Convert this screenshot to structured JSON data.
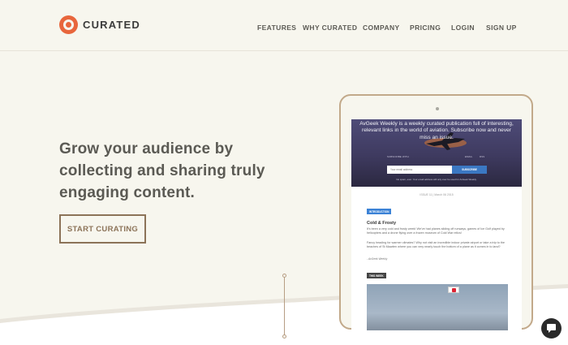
{
  "brand": {
    "name": "CURATED",
    "accent": "#e8663c"
  },
  "nav": {
    "items": [
      {
        "label": "FEATURES"
      },
      {
        "label": "WHY CURATED"
      },
      {
        "label": "COMPANY"
      },
      {
        "label": "PRICING"
      },
      {
        "label": "LOGIN"
      },
      {
        "label": "SIGN UP"
      }
    ]
  },
  "hero": {
    "headline": "Grow your audience by collecting and sharing truly engaging content.",
    "cta_label": "START CURATING"
  },
  "newsletter_preview": {
    "hero_text": "AvGeek Weekly is a weekly curated publication full of interesting, relevant links in the world of aviation. Subscribe now and never miss an issue.",
    "sub_links": [
      "SUBSCRIBE WITH",
      "EMAIL",
      "RSS"
    ],
    "email_placeholder": "Your email address",
    "subscribe_label": "SUBSCRIBE",
    "spam_note": "No spam, ever. Your email address will only ever be used for AvGeek Weekly.",
    "issue_line": "ISSUE 11 | March 06 2015",
    "intro_tag": "INTRODUCTION",
    "article_title": "Cold & Frosty",
    "paragraph_1": "It's been a very cold and frosty week! We've had planes sliding off runways, games of Ice Golf played by helicopters and a drone flying over a frozen museum of Cold War relics!",
    "paragraph_2": "Fancy heading for warmer climates? Why not visit an incredible indoor private airport or take a trip to the beaches of St Maarten where you can very nearly touch the bottom of a plane as it comes in to land?",
    "signature": "- AvGeek Weekly",
    "week_tag": "THIS WEEK"
  },
  "chat": {
    "icon": "chat-bubble-icon"
  }
}
